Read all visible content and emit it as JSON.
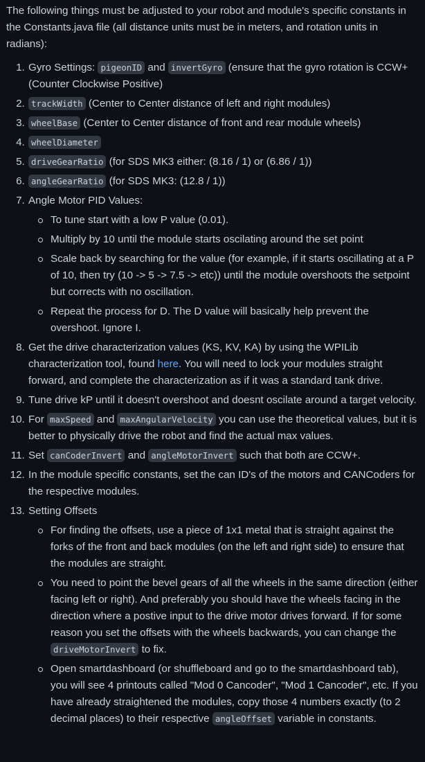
{
  "intro": "The following things must be adjusted to your robot and module's specific constants in the Constants.java file (all distance units must be in meters, and rotation units in radians):",
  "steps": [
    {
      "t1": "Gyro Settings: ",
      "c1": "pigeonID",
      "t2": " and ",
      "c2": "invertGyro",
      "t3": " (ensure that the gyro rotation is CCW+ (Counter Clockwise Positive)"
    },
    {
      "c1": "trackWidth",
      "t1": " (Center to Center distance of left and right modules)"
    },
    {
      "c1": "wheelBase",
      "t1": " (Center to Center distance of front and rear module wheels)"
    },
    {
      "c1": "wheelDiameter"
    },
    {
      "c1": "driveGearRatio",
      "t1": " (for SDS MK3 either: (8.16 / 1) or (6.86 / 1))"
    },
    {
      "c1": "angleGearRatio",
      "t1": " (for SDS MK3: (12.8 / 1))"
    },
    {
      "t1": "Angle Motor PID Values:",
      "sub": [
        "To tune start with a low P value (0.01).",
        "Multiply by 10 until the module starts oscilating around the set point",
        "Scale back by searching for the value (for example, if it starts oscillating at a P of 10, then try (10 -> 5 -> 7.5 -> etc)) until the module overshoots the setpoint but corrects with no oscillation.",
        "Repeat the process for D. The D value will basically help prevent the overshoot. Ignore I."
      ]
    },
    {
      "t1": "Get the drive characterization values (KS, KV, KA) by using the WPILib characterization tool, found ",
      "link": "here",
      "t2": ". You will need to lock your modules straight forward, and complete the characterization as if it was a standard tank drive."
    },
    {
      "t1": "Tune drive kP until it doesn't overshoot and doesnt oscilate around a target velocity."
    },
    {
      "t1": "For ",
      "c1": "maxSpeed",
      "t2": " and ",
      "c2": "maxAngularVelocity",
      "t3": " you can use the theoretical values, but it is better to physically drive the robot and find the actual max values."
    },
    {
      "t1": "Set ",
      "c1": "canCoderInvert",
      "t2": " and ",
      "c2": "angleMotorInvert",
      "t3": " such that both are CCW+."
    },
    {
      "t1": "In the module specific constants, set the can ID's of the motors and CANCoders for the respective modules."
    },
    {
      "t1": "Setting Offsets",
      "sub1": "For finding the offsets, use a piece of 1x1 metal that is straight against the forks of the front and back modules (on the left and right side) to ensure that the modules are straight.",
      "sub2_t1": "You need to point the bevel gears of all the wheels in the same direction (either facing left or right). And preferably you should have the wheels facing in the direction where a postive input to the drive motor drives forward. If for some reason you set the offsets with the wheels backwards, you can change the ",
      "sub2_c1": "driveMotorInvert",
      "sub2_t2": " to fix.",
      "sub3_t1": "Open smartdashboard (or shuffleboard and go to the smartdashboard tab), you will see 4 printouts called \"Mod 0 Cancoder\", \"Mod 1 Cancoder\", etc. If you have already straightened the modules, copy those 4 numbers exactly (to 2 decimal places) to their respective ",
      "sub3_c1": "angleOffset",
      "sub3_t2": " variable in constants."
    }
  ]
}
